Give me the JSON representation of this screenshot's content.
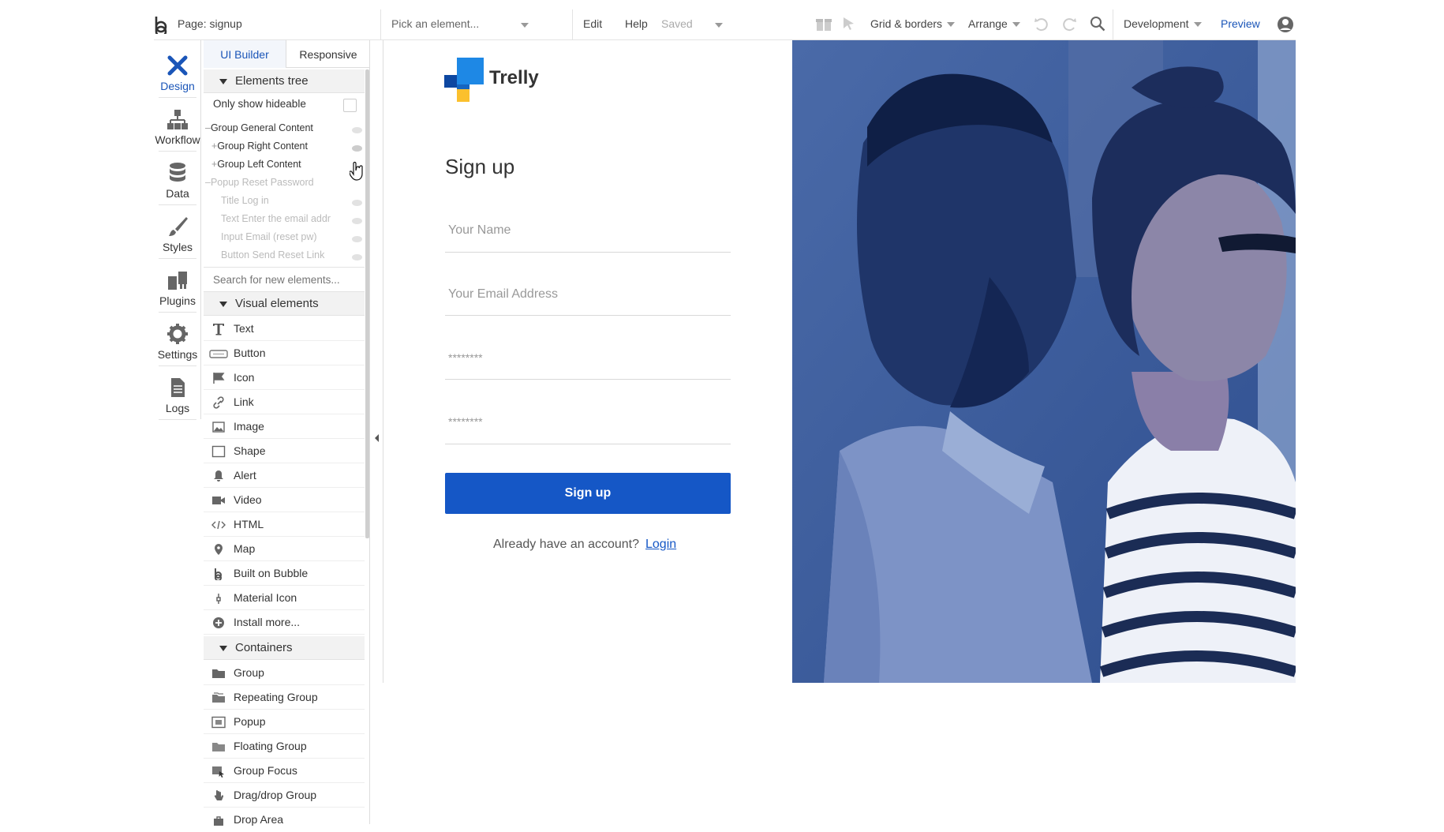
{
  "topbar": {
    "page_label": "Page: signup",
    "pick_element": "Pick an element...",
    "edit": "Edit",
    "help": "Help",
    "saved": "Saved",
    "grid_borders": "Grid & borders",
    "arrange": "Arrange",
    "development": "Development",
    "preview": "Preview"
  },
  "rail": {
    "design": "Design",
    "workflow": "Workflow",
    "data": "Data",
    "styles": "Styles",
    "plugins": "Plugins",
    "settings": "Settings",
    "logs": "Logs"
  },
  "palette": {
    "tab_ui_builder": "UI Builder",
    "tab_responsive": "Responsive",
    "elements_tree": "Elements tree",
    "only_show_hideable": "Only show hideable",
    "tree": [
      "Group General Content",
      "Group Right Content",
      "Group Left Content",
      "Popup Reset Password",
      "Title Log in",
      "Text Enter the email addr",
      "Input Email (reset pw)",
      "Button Send Reset Link"
    ],
    "search_placeholder": "Search for new elements...",
    "visual_elements": "Visual elements",
    "visual": [
      "Text",
      "Button",
      "Icon",
      "Link",
      "Image",
      "Shape",
      "Alert",
      "Video",
      "HTML",
      "Map",
      "Built on Bubble",
      "Material Icon",
      "Install more..."
    ],
    "containers": "Containers",
    "container_items": [
      "Group",
      "Repeating Group",
      "Popup",
      "Floating Group",
      "Group Focus",
      "Drag/drop Group",
      "Drop Area"
    ]
  },
  "canvas": {
    "brand": "Trelly",
    "heading": "Sign up",
    "name_placeholder": "Your Name",
    "email_placeholder": "Your Email Address",
    "password_1": "********",
    "password_2": "********",
    "signup_button": "Sign up",
    "already_text": "Already have an account?",
    "login_link": "Login"
  },
  "colors": {
    "accent": "#1a55b8",
    "button": "#1557c6",
    "photo_tint": "#3a5f9c"
  }
}
